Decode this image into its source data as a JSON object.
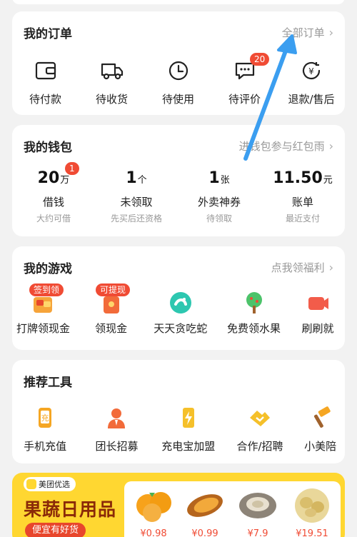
{
  "orders": {
    "title": "我的订单",
    "link": "全部订单",
    "items": [
      {
        "label": "待付款",
        "icon": "wallet-icon"
      },
      {
        "label": "待收货",
        "icon": "truck-icon"
      },
      {
        "label": "待使用",
        "icon": "clock-icon"
      },
      {
        "label": "待评价",
        "icon": "comment-icon",
        "badge": "20"
      },
      {
        "label": "退款/售后",
        "icon": "refund-icon"
      }
    ]
  },
  "wallet": {
    "title": "我的钱包",
    "link": "进钱包参与红包雨",
    "items": [
      {
        "num": "20",
        "unit": "万",
        "label": "借钱",
        "sub": "大约可借",
        "badge": "1"
      },
      {
        "num": "1",
        "unit": "个",
        "label": "未领取",
        "sub": "先买后还资格"
      },
      {
        "num": "1",
        "unit": "张",
        "label": "外卖神券",
        "sub": "待领取"
      },
      {
        "num": "11.50",
        "unit": "元",
        "label": "账单",
        "sub": "最近支付"
      }
    ]
  },
  "games": {
    "title": "我的游戏",
    "link": "点我领福利",
    "items": [
      {
        "label": "打牌领现金",
        "tag": "签到领",
        "icon": "cards-game-icon"
      },
      {
        "label": "领现金",
        "tag": "可提现",
        "icon": "cash-envelope-icon"
      },
      {
        "label": "天天贪吃蛇",
        "icon": "snake-game-icon"
      },
      {
        "label": "免费领水果",
        "icon": "fruit-tree-icon"
      },
      {
        "label": "刷刷就",
        "icon": "video-icon"
      }
    ]
  },
  "tools": {
    "title": "推荐工具",
    "items": [
      {
        "label": "手机充值",
        "icon": "phone-recharge-icon"
      },
      {
        "label": "团长招募",
        "icon": "leader-recruit-icon"
      },
      {
        "label": "充电宝加盟",
        "icon": "power-bank-icon"
      },
      {
        "label": "合作/招聘",
        "icon": "handshake-icon"
      },
      {
        "label": "小美陪",
        "icon": "hammer-icon"
      }
    ]
  },
  "promo": {
    "brand": "美团优选",
    "headline": "果蔬日用品",
    "sub": "便宜有好货",
    "products": [
      {
        "price": "¥0.98",
        "icon": "orange-icon"
      },
      {
        "price": "¥0.99",
        "icon": "sweet-potato-icon"
      },
      {
        "price": "¥7.9",
        "icon": "oyster-icon"
      },
      {
        "price": "¥19.51",
        "icon": "potato-icon"
      }
    ]
  },
  "colors": {
    "accent": "#f5a623",
    "badge": "#f04b34",
    "arrow": "#3b9ef0",
    "promo_bg": "#ffd731"
  }
}
